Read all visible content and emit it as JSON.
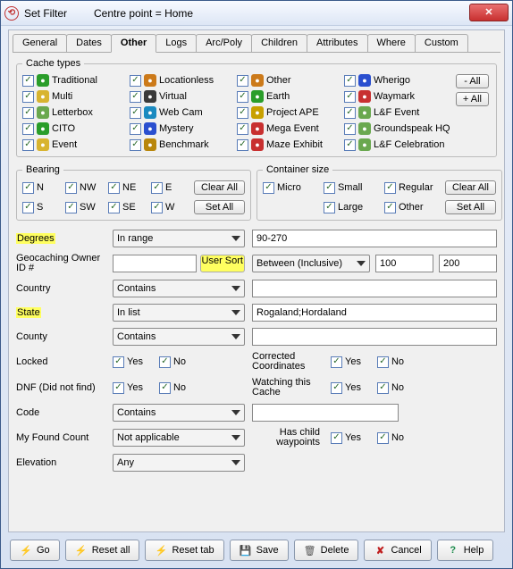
{
  "titlebar": {
    "title": "Set Filter",
    "subtitle": "Centre point = Home"
  },
  "tabs": [
    "General",
    "Dates",
    "Other",
    "Logs",
    "Arc/Poly",
    "Children",
    "Attributes",
    "Where",
    "Custom"
  ],
  "active_tab": "Other",
  "cache_types": {
    "legend": "Cache types",
    "side_all": "- All",
    "side_plus": "+ All",
    "grid": [
      [
        "Traditional",
        "Locationless",
        "Other",
        "Wherigo"
      ],
      [
        "Multi",
        "Virtual",
        "Earth",
        "Waymark"
      ],
      [
        "Letterbox",
        "Web Cam",
        "Project APE",
        "L&F Event"
      ],
      [
        "CITO",
        "Mystery",
        "Mega Event",
        "Groundspeak HQ"
      ],
      [
        "Event",
        "Benchmark",
        "Maze Exhibit",
        "L&F Celebration"
      ]
    ],
    "icon_colors": [
      [
        "#2a9d2a",
        "#cc7a1a",
        "#cc7a1a",
        "#2a4fcf"
      ],
      [
        "#d8b430",
        "#3a3a3a",
        "#2a9d2a",
        "#c83030"
      ],
      [
        "#6aa84f",
        "#1a8ac0",
        "#c8a000",
        "#6aa84f"
      ],
      [
        "#2a9d2a",
        "#2a4fcf",
        "#c83030",
        "#6aa84f"
      ],
      [
        "#d8b430",
        "#b8860b",
        "#c83030",
        "#6aa84f"
      ]
    ]
  },
  "bearing": {
    "legend": "Bearing",
    "dirs": [
      "N",
      "NW",
      "NE",
      "E",
      "S",
      "SW",
      "SE",
      "W"
    ],
    "clear": "Clear All",
    "set": "Set All"
  },
  "container": {
    "legend": "Container size",
    "sizes_row1": [
      "Micro",
      "Small",
      "Regular"
    ],
    "sizes_row2_pad": "",
    "sizes_row2": [
      "Large",
      "Other"
    ],
    "clear": "Clear All",
    "set": "Set All"
  },
  "rows": {
    "degrees": {
      "label": "Degrees",
      "combo": "In range",
      "value": "90-270"
    },
    "owner": {
      "label": "Geocaching Owner ID #",
      "btn": "User Sort",
      "combo": "Between (Inclusive)",
      "v1": "100",
      "v2": "200"
    },
    "country": {
      "label": "Country",
      "combo": "Contains",
      "value": ""
    },
    "state": {
      "label": "State",
      "combo": "In list",
      "value": "Rogaland;Hordaland"
    },
    "county": {
      "label": "County",
      "combo": "Contains",
      "value": ""
    },
    "locked": {
      "label": "Locked",
      "yes": "Yes",
      "no": "No",
      "sub": "Corrected Coordinates"
    },
    "dnf": {
      "label": "DNF (Did not find)",
      "yes": "Yes",
      "no": "No",
      "sub": "Watching this Cache"
    },
    "code": {
      "label": "Code",
      "combo": "Contains",
      "value": ""
    },
    "found": {
      "label": "My Found Count",
      "combo": "Not applicable",
      "sub": "Has child waypoints",
      "yes": "Yes",
      "no": "No"
    },
    "elev": {
      "label": "Elevation",
      "combo": "Any"
    }
  },
  "buttons": {
    "go": "Go",
    "resetall": "Reset all",
    "resettab": "Reset tab",
    "save": "Save",
    "delete": "Delete",
    "cancel": "Cancel",
    "help": "Help"
  }
}
